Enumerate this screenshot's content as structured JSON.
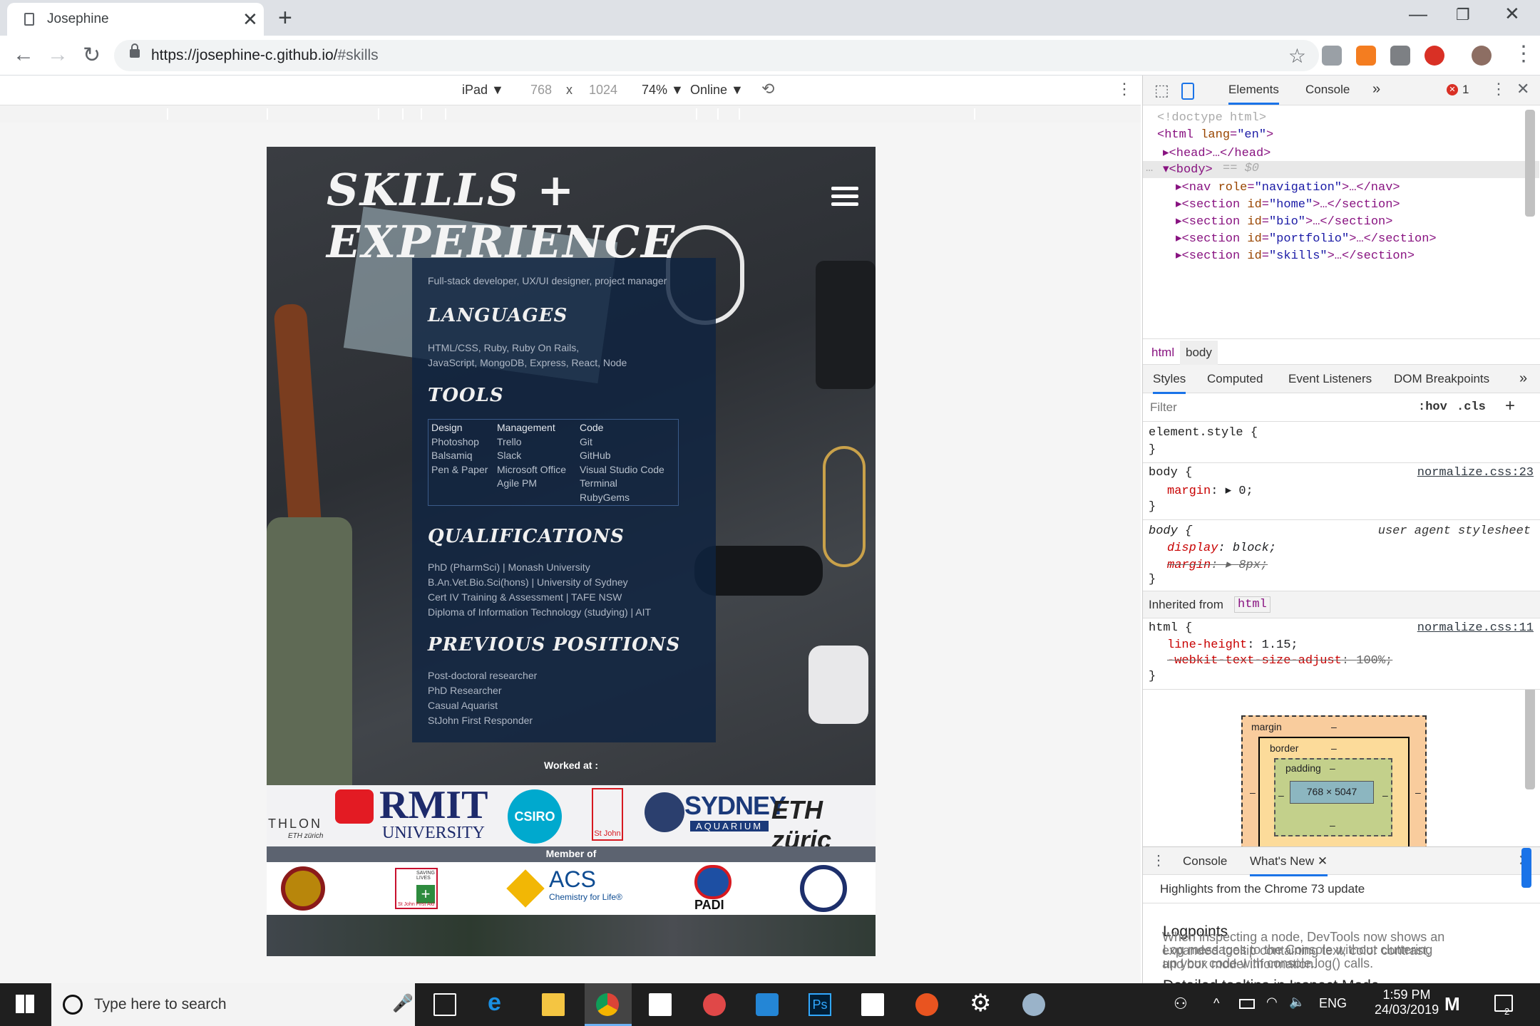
{
  "browser": {
    "tab_title": "Josephine",
    "url_host": "https://josephine-c.github.io/",
    "url_path": "#skills"
  },
  "device_toolbar": {
    "device": "iPad ▼",
    "width": "768",
    "times": "x",
    "height": "1024",
    "zoom": "74% ▼",
    "network": "Online ▼"
  },
  "site": {
    "heading": "Skills + Experience",
    "subtitle": "Full-stack developer, UX/UI designer, project manager",
    "languages_title": "Languages",
    "languages_line1": "HTML/CSS, Ruby, Ruby On Rails,",
    "languages_line2": "JavaScript, MongoDB, Express, React, Node",
    "tools_title": "Tools",
    "tools": {
      "design_head": "Design",
      "design_items": [
        "Photoshop",
        "Balsamiq",
        "Pen & Paper"
      ],
      "management_head": "Management",
      "management_items": [
        "Trello",
        "Slack",
        "Microsoft Office",
        "Agile PM"
      ],
      "code_head": "Code",
      "code_items": [
        "Git",
        "GitHub",
        "Visual Studio Code",
        "Terminal",
        "RubyGems"
      ]
    },
    "qualifications_title": "Qualifications",
    "qualifications": [
      "PhD (PharmSci) | Monash University",
      "B.An.Vet.Bio.Sci(hons) | University of Sydney",
      "Cert IV Training & Assessment | TAFE NSW",
      "Diploma of Information Technology (studying) | AIT"
    ],
    "positions_title": "Previous positions",
    "positions": [
      "Post-doctoral researcher",
      "PhD Researcher",
      "Casual Aquarist",
      "StJohn First Responder"
    ],
    "worked_at": "Worked at :",
    "worked_logos": {
      "eth_left": "THLON",
      "eth_left_sub": "ETH zürich",
      "rmit_1": "RMIT",
      "rmit_2": "UNIVERSITY",
      "csiro": "CSIRO",
      "stjohn": "St John",
      "sydney_1": "SYDNEY",
      "sydney_2": "AQUARIUM",
      "eth": "ETH züric"
    },
    "member_of": "Member of",
    "member_logos": {
      "acs": "ACS",
      "acs_sub": "Chemistry for Life®",
      "padi": "PADI",
      "stjohn_1": "SAVING LIVES",
      "stjohn_2": "St John First Aid"
    }
  },
  "devtools": {
    "tabs": [
      "Elements",
      "Console",
      "»"
    ],
    "error_count": "1",
    "dom": [
      {
        "indent": 0,
        "html": "<!doctype html>"
      },
      {
        "indent": 0,
        "tag": "html",
        "attr": "lang",
        "val": "\"en\""
      }
    ],
    "dom_lines": {
      "doctype": "<!doctype html>",
      "html_open": "<html ",
      "html_attr": "lang",
      "html_val": "\"en\"",
      "head": "<head>…</head>",
      "body": "<body>",
      "body_eq": " == $0",
      "nav": "<nav ",
      "nav_attr": "role",
      "nav_val": "\"navigation\"",
      "nav_close": ">…</nav>",
      "sections": [
        {
          "id": "\"home\""
        },
        {
          "id": "\"bio\""
        },
        {
          "id": "\"portfolio\""
        },
        {
          "id": "\"skills\""
        }
      ],
      "section_open": "<section ",
      "section_attr": "id",
      "section_close": ">…</section>"
    },
    "breadcrumb": [
      "html",
      "body"
    ],
    "styles_tabs": [
      "Styles",
      "Computed",
      "Event Listeners",
      "DOM Breakpoints",
      "»"
    ],
    "filter_placeholder": "Filter",
    "hov": ":hov",
    "cls": ".cls",
    "plus": "+",
    "rules": {
      "element_style": "element.style {",
      "close": "}",
      "body": "body {",
      "normalize23": "normalize.css:23",
      "margin": "margin",
      "margin_val": "0;",
      "user_agent": "user agent stylesheet",
      "display": "display",
      "display_val": "block;",
      "margin8": "8px;",
      "inherited": "Inherited from",
      "inherited_tag": "html",
      "html": "html {",
      "normalize11": "normalize.css:11",
      "line_height": "line-height",
      "line_height_val": "1.15;",
      "webkit": "-webkit-text-size-adjust",
      "webkit_val": "100%;"
    },
    "box_model": {
      "margin": "margin",
      "border": "border",
      "padding": "padding",
      "dash": "–",
      "size": "768 × 5047"
    },
    "drawer": {
      "tabs": [
        "Console",
        "What's New"
      ],
      "headline": "Highlights from the Chrome 73 update",
      "items": [
        {
          "title": "Logpoints",
          "text1": "Log messages to the Console without cluttering",
          "text2": "up your code with console.log() calls."
        },
        {
          "title": "Detailed tooltips in Inspect Mode",
          "text1": "When inspecting a node, DevTools now shows an",
          "text2": "expanded tooltip containing text, color contrast,",
          "text3": "and box model information."
        }
      ]
    }
  },
  "taskbar": {
    "search_placeholder": "Type here to search",
    "lang": "ENG",
    "time": "1:59 PM",
    "date": "24/03/2019",
    "notif_count": "2"
  },
  "colors": {
    "card": "#0f2341",
    "accent_blue": "#1a73e8"
  }
}
